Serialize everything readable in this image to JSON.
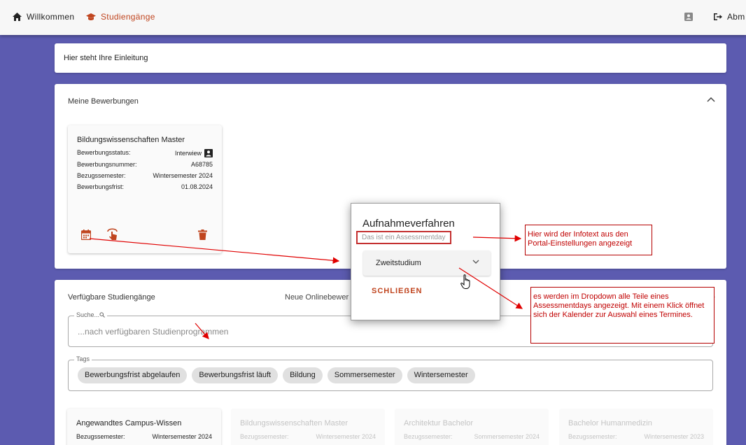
{
  "nav": {
    "home_label": "Willkommen",
    "programs_label": "Studiengänge",
    "logout_label": "Abm",
    "accent_color": "#c0451f"
  },
  "intro": {
    "text": "Hier steht Ihre Einleitung"
  },
  "applications": {
    "title": "Meine Bewerbungen",
    "card": {
      "title": "Bildungswissenschaften Master",
      "rows": [
        {
          "label": "Bewerbungsstatus:",
          "value": "Interwiew"
        },
        {
          "label": "Bewerbungsnummer:",
          "value": "A68785"
        },
        {
          "label": "Bezugssemester:",
          "value": "Wintersemester 2024"
        },
        {
          "label": "Bewerbungsfrist:",
          "value": "01.08.2024"
        }
      ],
      "actions": [
        "calendar-icon",
        "tap-icon",
        "delete-icon"
      ]
    }
  },
  "available": {
    "title": "Verfügbare Studiengänge",
    "online_label": "Neue Onlinebewer",
    "search": {
      "label": "Suche...",
      "placeholder": "...nach verfügbaren Studienprogrammen"
    },
    "tags_label": "Tags",
    "tags": [
      "Bewerbungsfrist abgelaufen",
      "Bewerbungsfrist läuft",
      "Bildung",
      "Sommersemester",
      "Wintersemester"
    ],
    "programs": [
      {
        "title": "Angewandtes Campus-Wissen",
        "label": "Bezugssemester:",
        "value": "Wintersemester 2024"
      },
      {
        "title": "Bildungswissenschaften Master",
        "label": "Bezugssemester:",
        "value": "Wintersemester 2024"
      },
      {
        "title": "Architektur Bachelor",
        "label": "Bezugssemester:",
        "value": "Sommersemester 2024"
      },
      {
        "title": "Bachelor Humanmedizin",
        "label": "Bezugssemester:",
        "value": "Wintersemester 2023"
      }
    ]
  },
  "dialog": {
    "title": "Aufnahmeverfahren",
    "info": "Das ist ein Assessmentday",
    "select_value": "Zweitstudium",
    "close_label": "SCHLIEẞEN"
  },
  "annotations": {
    "note_infotext": "Hier wird der Infotext aus den Portal-Einstellungen angezeigt",
    "note_dropdown": "es werden im Dropdown alle Teile eines Assessmentdays angezeigt. Mit einem Klick öffnet sich der Kalender zur Auswahl eines Termines.",
    "color": "#c00000"
  }
}
